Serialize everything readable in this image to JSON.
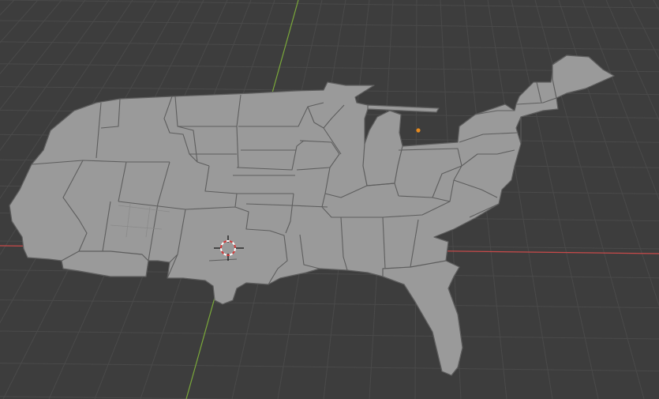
{
  "app": "Blender",
  "viewport": {
    "view": "3d-viewport-perspective",
    "background_color": "#3d3d3d",
    "grid_line_color": "#4a4a4a",
    "x_axis_color": "#c94a4a",
    "y_axis_color": "#7aa83a"
  },
  "scene": {
    "object": "us-states-map-mesh",
    "mesh_color": "#9a9a9a",
    "edge_color": "#5e5e5e",
    "light_color": "#e68a1f",
    "cursor_icon": "3d-cursor-icon"
  }
}
